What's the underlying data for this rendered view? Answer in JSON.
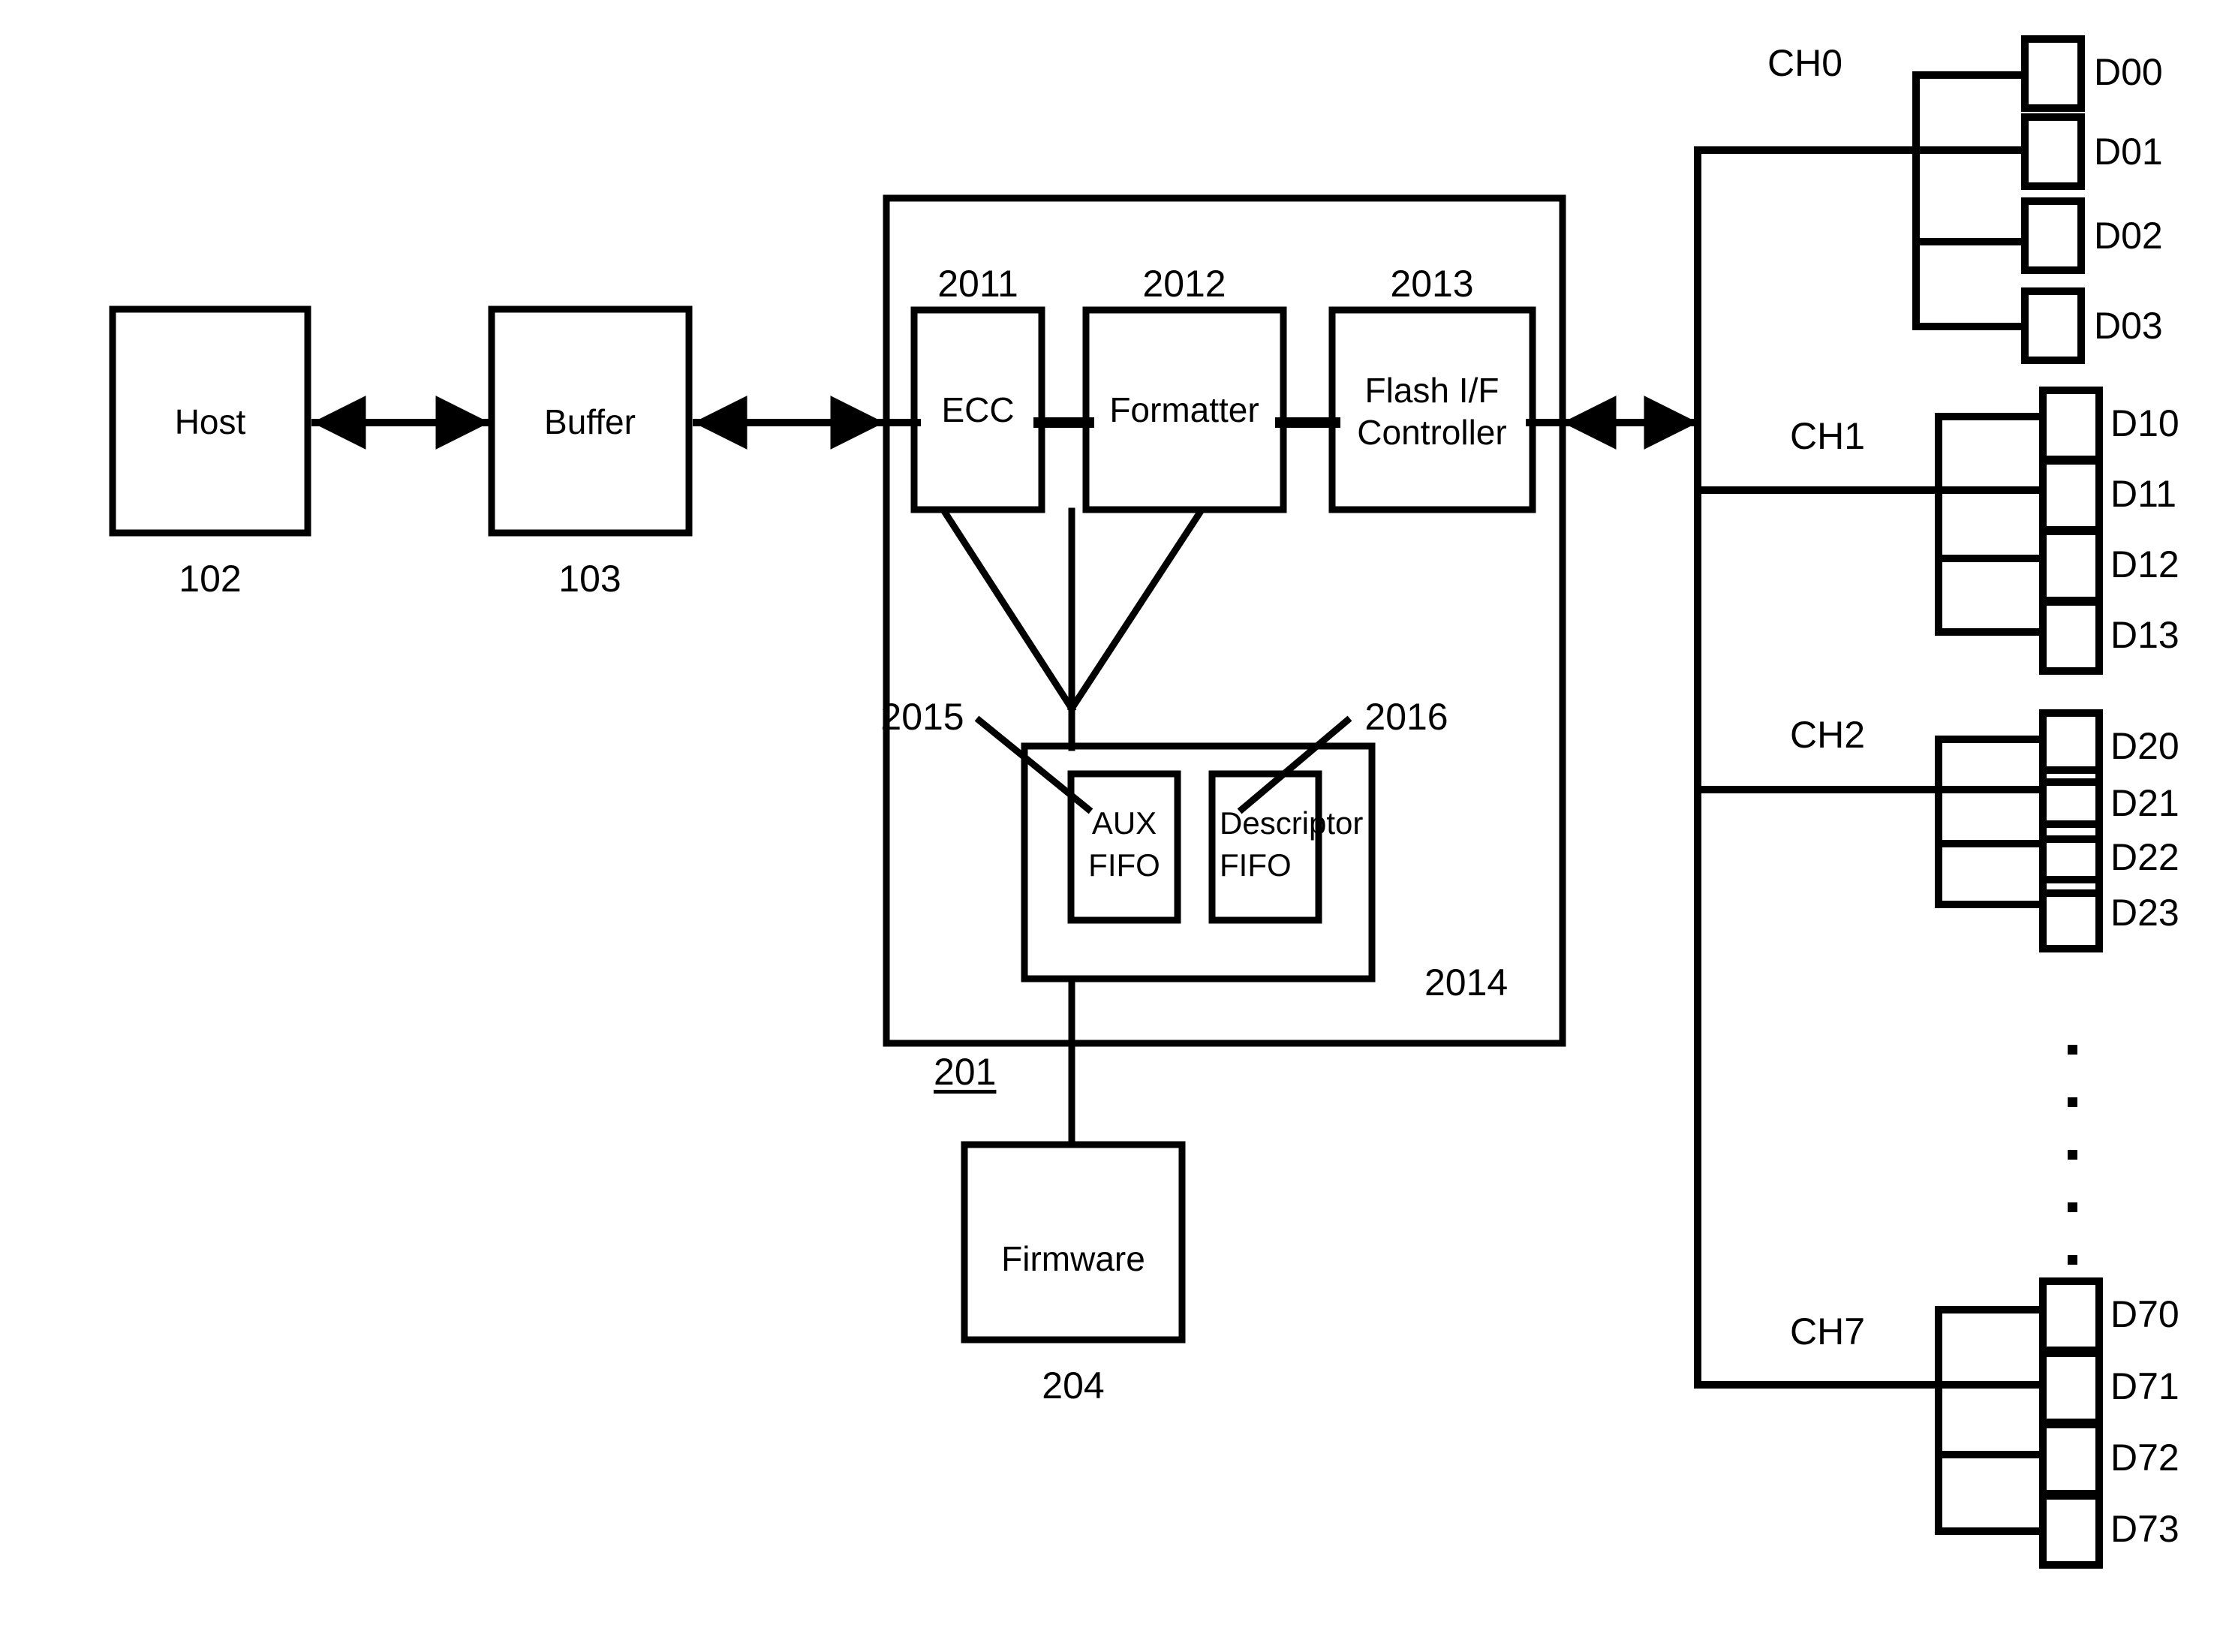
{
  "figure": {
    "kind": "block-diagram",
    "background": "#ffffff",
    "line_color": "#000000"
  },
  "left_chain": {
    "host": {
      "label": "Host",
      "ref": "102"
    },
    "buffer": {
      "label": "Buffer",
      "ref": "103"
    }
  },
  "controller": {
    "ref": "201",
    "blocks": [
      {
        "label": "ECC",
        "ref": "2011"
      },
      {
        "label": "Formatter",
        "ref": "2012"
      },
      {
        "label_line1": "Flash I/F",
        "label_line2": "Controller",
        "ref": "2013"
      }
    ],
    "fifo_group": {
      "ref": "2014",
      "fifos": [
        {
          "label_line1": "AUX",
          "label_line2": "FIFO",
          "ref": "2015"
        },
        {
          "label_line1": "Descriptor",
          "label_line2": "FIFO",
          "ref": "2016"
        }
      ]
    }
  },
  "firmware": {
    "label": "Firmware",
    "ref": "204"
  },
  "flash_array": {
    "ellipsis": "vertical-dots",
    "channels": [
      {
        "name": "CH0",
        "dies": [
          "D00",
          "D01",
          "D02",
          "D03"
        ]
      },
      {
        "name": "CH1",
        "dies": [
          "D10",
          "D11",
          "D12",
          "D13"
        ]
      },
      {
        "name": "CH2",
        "dies": [
          "D20",
          "D21",
          "D22",
          "D23"
        ]
      },
      {
        "name": "CH7",
        "dies": [
          "D70",
          "D71",
          "D72",
          "D73"
        ]
      }
    ]
  },
  "connectors": {
    "host_buffer": "double-arrow",
    "buffer_controller": "double-arrow",
    "controller_flash": "double-arrow"
  }
}
